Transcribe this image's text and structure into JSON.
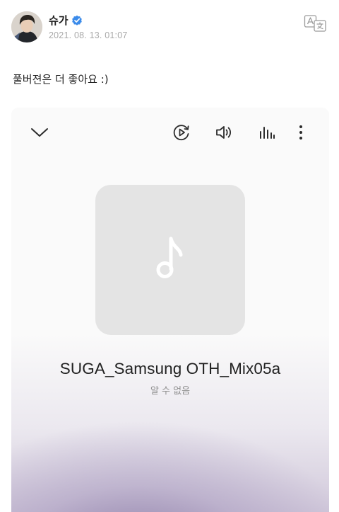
{
  "post": {
    "author": "슈가",
    "timestamp": "2021. 08. 13. 01:07",
    "text": "풀버젼은 더 좋아요 :)"
  },
  "icons": {
    "avatar": "avatar-photo",
    "verified": "verified-badge-icon",
    "translate": "translate-icon",
    "collapse": "chevron-down-icon",
    "repeat": "repeat-play-icon",
    "volume": "volume-icon",
    "equalizer": "equalizer-icon",
    "more": "more-vertical-icon",
    "music_note": "music-note-icon"
  },
  "player": {
    "track_title": "SUGA_Samsung OTH_Mix05a",
    "artist": "알 수 없음"
  },
  "colors": {
    "verified_blue": "#3b8bea",
    "icon_gray": "#2b2b2b",
    "album_placeholder": "#e4e4e4",
    "gradient_purple": "#7664a0"
  }
}
